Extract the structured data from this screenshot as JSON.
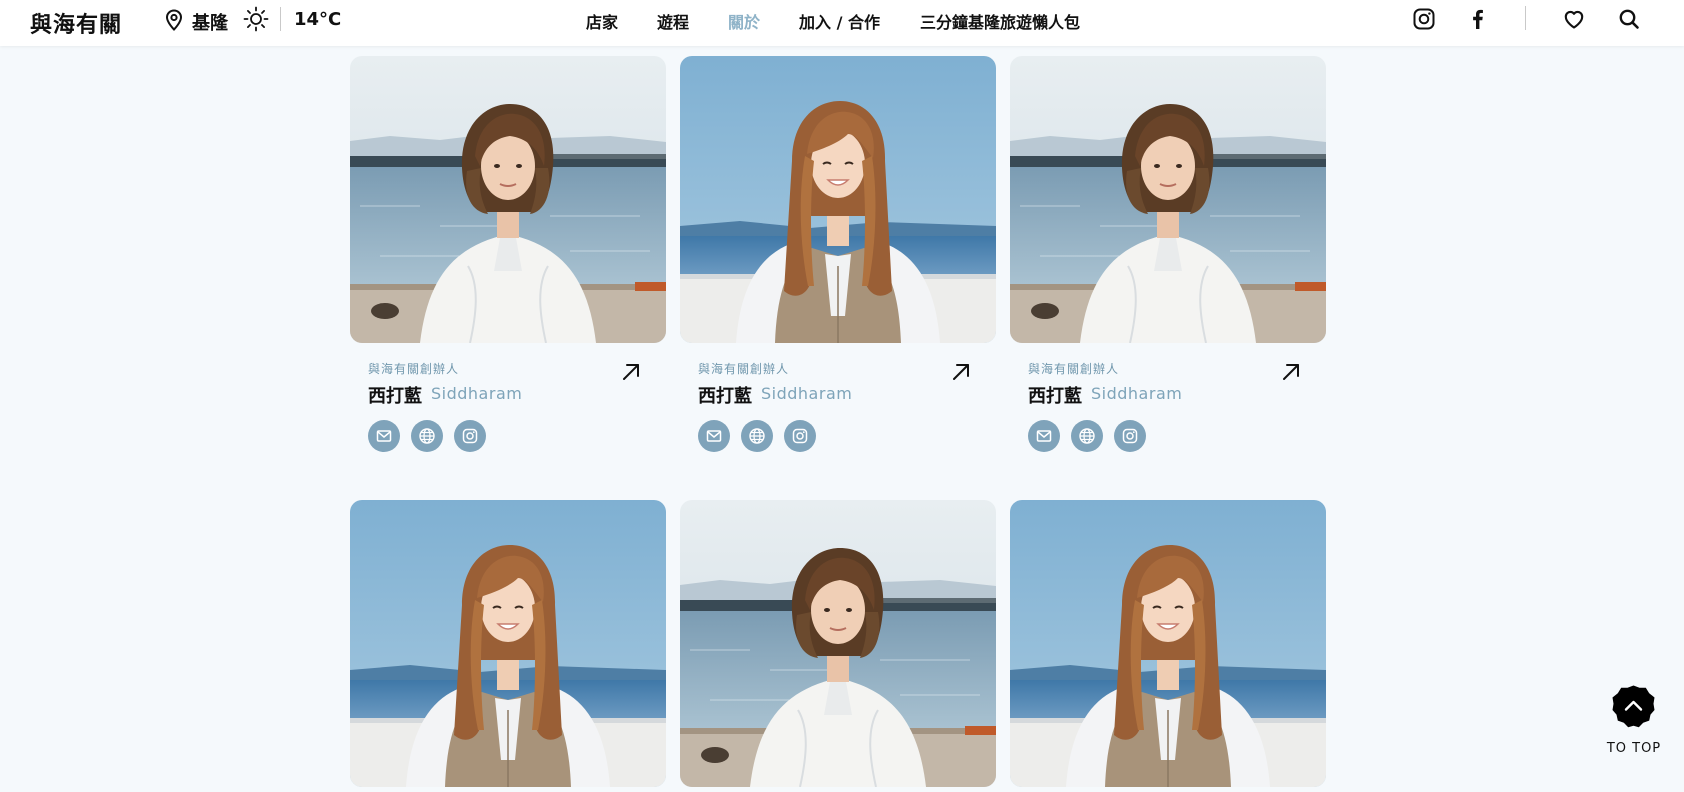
{
  "header": {
    "logo": "與海有關",
    "location": "基隆",
    "temperature": "14°C",
    "nav": [
      "店家",
      "遊程",
      "關於",
      "加入 / 合作",
      "三分鐘基隆旅遊懶人包"
    ],
    "active_nav": "關於",
    "icons": [
      "instagram-icon",
      "facebook-icon",
      "heart-icon",
      "search-icon"
    ]
  },
  "team": [
    {
      "role": "與海有關創辦人",
      "name_zh": "西打藍",
      "name_en": "Siddharam",
      "photo": "short-hair-white-sweater"
    },
    {
      "role": "與海有關創辦人",
      "name_zh": "西打藍",
      "name_en": "Siddharam",
      "photo": "long-hair-beige-vest"
    },
    {
      "role": "與海有關創辦人",
      "name_zh": "西打藍",
      "name_en": "Siddharam",
      "photo": "short-hair-white-sweater"
    },
    {
      "role": "",
      "name_zh": "",
      "name_en": "",
      "photo": "long-hair-beige-vest"
    },
    {
      "role": "",
      "name_zh": "",
      "name_en": "",
      "photo": "short-hair-white-sweater"
    },
    {
      "role": "",
      "name_zh": "",
      "name_en": "",
      "photo": "long-hair-beige-vest"
    }
  ],
  "social_icons": [
    "mail-icon",
    "globe-icon",
    "instagram-icon"
  ],
  "to_top": "TO TOP",
  "colors": {
    "accent": "#7fa3ba",
    "active_nav": "#8fb3c8",
    "background": "#f5f9fc"
  }
}
